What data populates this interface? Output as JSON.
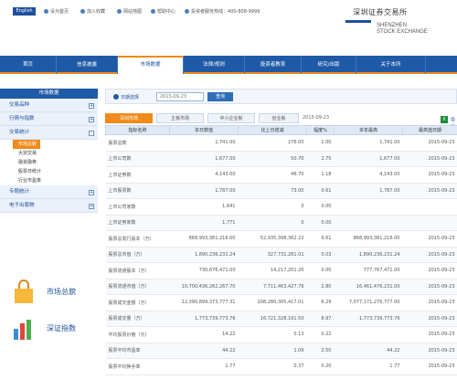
{
  "top": {
    "english_label": "English",
    "links": [
      "设为首页",
      "加入收藏",
      "网站地图",
      "帮助中心",
      "投资者服务热线：400-808-9999"
    ]
  },
  "logo": {
    "cn": "深圳证券交易所",
    "en_line1": "SHENZHEN",
    "en_line2": "STOCK EXCHANGE"
  },
  "nav": [
    "首页",
    "信息披露",
    "市场数据",
    "法律/规则",
    "投资者教育",
    "研究/出版",
    "关于本所"
  ],
  "nav_active_index": 2,
  "sidebar": {
    "head": "市场数据",
    "items": [
      {
        "label": "交易品种",
        "toggle": "+"
      },
      {
        "label": "行情与指数",
        "toggle": "+"
      },
      {
        "label": "交易统计",
        "toggle": "-"
      }
    ],
    "sub_items": [
      "市场总貌",
      "大宗交易",
      "融资融券",
      "股票日统计",
      "行业市盈率"
    ],
    "items2": [
      {
        "label": "专题统计",
        "toggle": "+"
      },
      {
        "label": "电子出版物",
        "toggle": "+"
      }
    ],
    "promo1": "市场总貌",
    "promo2": "深证指数"
  },
  "filter": {
    "label": "日期选择",
    "date_placeholder": "2015-09-23",
    "query_label": "查询"
  },
  "tabs": [
    "深圳市场",
    "主板市场",
    "中小企业板",
    "创业板"
  ],
  "tab_date": "2015-09-23",
  "excel_label": "导出",
  "accent_color": "#f08a1a",
  "brand_color": "#1f5aa6",
  "table": {
    "headers": [
      "指标名称",
      "本日数值",
      "比上日增减",
      "幅度%",
      "本年最高",
      "最高值日期"
    ],
    "rows": [
      [
        "股票总数",
        "1,741.00",
        "276.00",
        "1.00",
        "1,741.00",
        "2015-09-23"
      ],
      [
        "上市公司数",
        "1,677.00",
        "50.70",
        "2.75",
        "1,677.00",
        "2015-09-23"
      ],
      [
        "上市证券数",
        "4,143.00",
        "46.70",
        "1.18",
        "4,143.00",
        "2015-09-23"
      ],
      [
        "上市股票数",
        "1,787.00",
        "73.00",
        "0.61",
        "1,787.00",
        "2015-09-23"
      ],
      [
        "上市公司家数",
        "1,641",
        "0",
        "0.00",
        "",
        ""
      ],
      [
        "上市证券家数",
        "1,771",
        "0",
        "0.00",
        "",
        ""
      ],
      [
        "股票总发行股本（万）",
        "868,993,381,216.00",
        "52,935,398,362.22",
        "9.61",
        "868,993,381,216.00",
        "2015-09-23"
      ],
      [
        "股票总市值（万）",
        "1,890,236,231.24",
        "327,731,281.01",
        "0.03",
        "1,890,236,231.24",
        "2015-09-23"
      ],
      [
        "股票流通股本（万）",
        "730,676,471.00",
        "14,217,201.20",
        "0.00",
        "777,767,471.00",
        "2015-09-23"
      ],
      [
        "股票流通市值（万）",
        "10,700,436,262,267.70",
        "7,711,463,427.76",
        "2.80",
        "16,461,476,231.00",
        "2015-09-23"
      ],
      [
        "股票成交金额（万）",
        "12,390,899,373,777.31",
        "208,280,305,417.01",
        "6.29",
        "7,077,171,276,777.00",
        "2015-09-23"
      ],
      [
        "股票成交量（万）",
        "1,773,739,773.76",
        "16,721,328,191.50",
        "8.97",
        "1,773,739,773.76",
        "2015-09-23"
      ],
      [
        "平均股票价格（元）",
        "14.22",
        "0.13",
        "0.22",
        "",
        "2015-09-23"
      ],
      [
        "股票平均市盈率",
        "44.22",
        "1.09",
        "2.50",
        "44.22",
        "2015-09-23"
      ],
      [
        "股票平均换手率",
        "1.77",
        "0.37",
        "0.20",
        "1.77",
        "2015-09-23"
      ]
    ]
  }
}
